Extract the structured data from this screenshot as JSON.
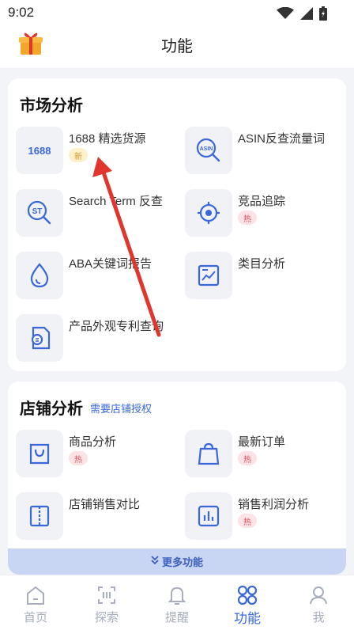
{
  "status": {
    "time": "9:02"
  },
  "header": {
    "title": "功能"
  },
  "market": {
    "title": "市场分析",
    "items": [
      {
        "label": "1688 精选货源",
        "icon_text": "1688",
        "badge": "新",
        "badge_type": "new",
        "icon": "1688-icon"
      },
      {
        "label": "ASIN反查流量词",
        "icon_text": "ASIN",
        "badge": "",
        "icon": "asin-search-icon"
      },
      {
        "label": "Search Term 反查",
        "icon_text": "ST",
        "badge": "",
        "icon": "st-search-icon"
      },
      {
        "label": "竞品追踪",
        "badge": "热",
        "badge_type": "hot",
        "icon": "target-icon"
      },
      {
        "label": "ABA关键词报告",
        "badge": "",
        "icon": "drop-icon"
      },
      {
        "label": "类目分析",
        "badge": "",
        "icon": "chart-image-icon"
      },
      {
        "label": "产品外观专利查询",
        "badge": "",
        "icon": "document-search-icon"
      }
    ]
  },
  "store": {
    "title": "店铺分析",
    "subtitle": "需要店铺授权",
    "items": [
      {
        "label": "商品分析",
        "badge": "热",
        "badge_type": "hot",
        "icon": "bag-icon"
      },
      {
        "label": "最新订单",
        "badge": "热",
        "badge_type": "hot",
        "icon": "shopping-bag-icon"
      },
      {
        "label": "店铺销售对比",
        "badge": "",
        "icon": "compare-icon"
      },
      {
        "label": "销售利润分析",
        "badge": "热",
        "badge_type": "hot",
        "icon": "bar-chart-icon"
      }
    ],
    "more_label": "更多功能"
  },
  "nav": [
    {
      "label": "首页",
      "icon": "home-icon",
      "active": false
    },
    {
      "label": "探索",
      "icon": "scan-icon",
      "active": false
    },
    {
      "label": "提醒",
      "icon": "bell-icon",
      "active": false
    },
    {
      "label": "功能",
      "icon": "grid-icon",
      "active": true
    },
    {
      "label": "我",
      "icon": "user-icon",
      "active": false
    }
  ],
  "colors": {
    "accent": "#3a68d8",
    "hot": "#e0505f",
    "new": "#d9962b",
    "arrow": "#e0362d"
  }
}
